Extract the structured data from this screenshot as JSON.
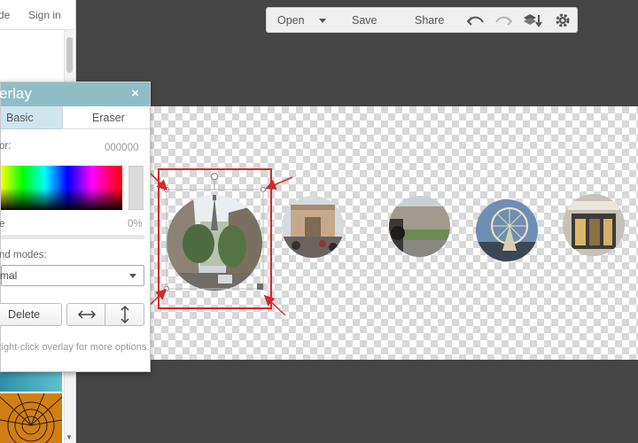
{
  "sidebar": {
    "top_link_left": "de",
    "sign_in": "Sign in"
  },
  "toolbar": {
    "open": "Open",
    "save": "Save",
    "share": "Share",
    "icons": [
      "undo-icon",
      "redo-icon",
      "layers-icon",
      "gear-icon"
    ]
  },
  "panel": {
    "title": "erlay",
    "close": "×",
    "tabs": {
      "basic": "Basic",
      "eraser": "Eraser"
    },
    "color_label": "or:",
    "color_value": "000000",
    "opacity_label": "e",
    "opacity_value": "0%",
    "blend_label": "nd modes:",
    "blend_value": "rmal",
    "delete": "Delete",
    "hint": "Right-click overlay for more options."
  },
  "colors": {
    "panel_header": "#8fbdc6",
    "tab_active": "#cfe6ee",
    "annotation_red": "#d9262b",
    "workspace": "#454545"
  }
}
